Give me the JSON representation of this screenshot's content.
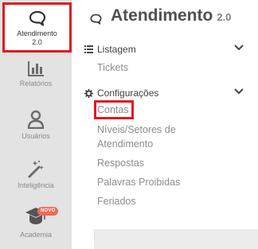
{
  "sidebar": {
    "items": [
      {
        "label": "Atendimento\n2.0",
        "icon": "chat-bubble-icon",
        "active": true
      },
      {
        "label": "Relatórios",
        "icon": "bar-chart-icon"
      },
      {
        "label": "Usuários",
        "icon": "user-icon"
      },
      {
        "label": "Inteligência",
        "icon": "magic-wand-icon"
      },
      {
        "label": "Academia",
        "icon": "graduation-cap-icon",
        "badge": "NOVO"
      }
    ]
  },
  "header": {
    "title": "Atendimento",
    "version": "2.0",
    "icon": "chat-bubble-icon"
  },
  "sections": [
    {
      "label": "Listagem",
      "icon": "list-icon",
      "links": [
        "Tickets"
      ]
    },
    {
      "label": "Configurações",
      "icon": "gear-icon",
      "links": [
        "Contas",
        "Níveis/Setores de",
        "Atendimento",
        "Respostas",
        "Palavras Proibidas",
        "Feriados"
      ]
    }
  ],
  "colors": {
    "highlight": "#e0191f",
    "badge": "#f06b55",
    "rail": "#e3e3e3"
  }
}
